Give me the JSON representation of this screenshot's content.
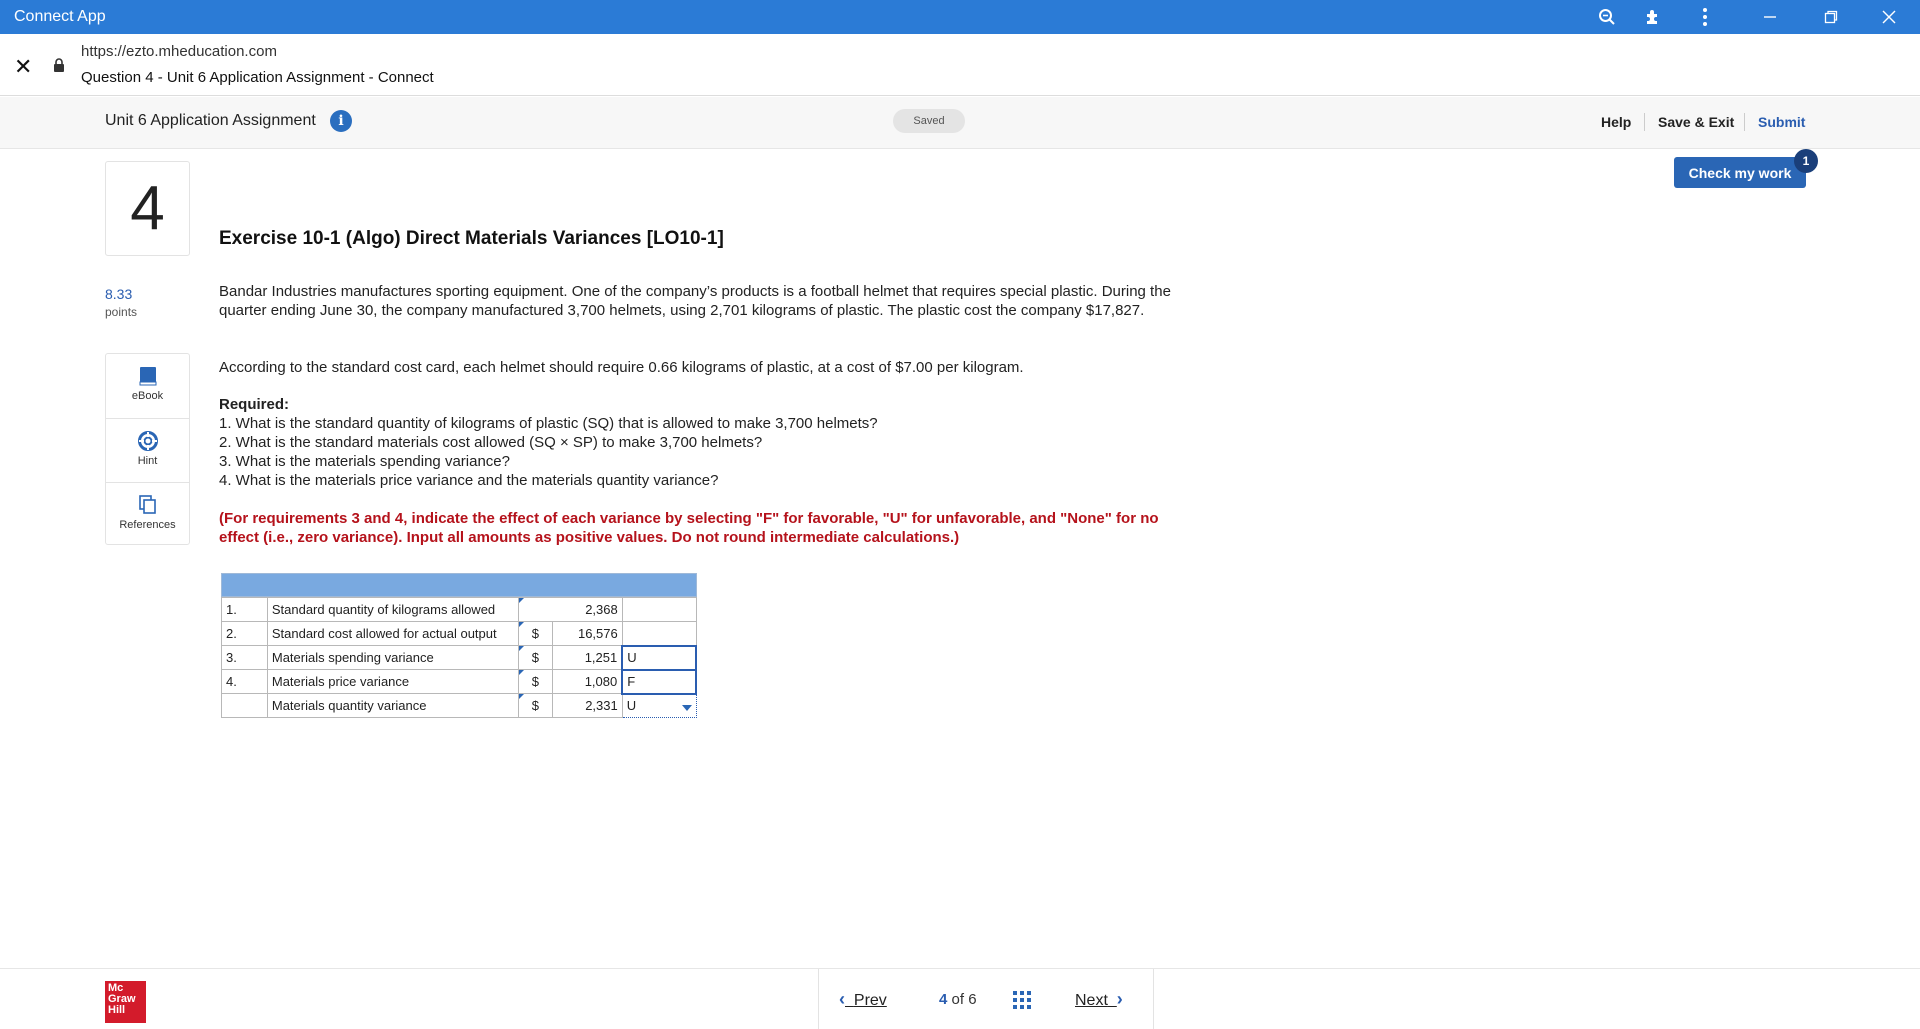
{
  "window": {
    "app_title": "Connect App"
  },
  "browser": {
    "url": "https://ezto.mheducation.com",
    "page_title": "Question 4 - Unit 6 Application Assignment - Connect"
  },
  "header": {
    "assignment_name": "Unit 6 Application Assignment",
    "info_glyph": "i",
    "saved_label": "Saved",
    "help_label": "Help",
    "save_exit_label": "Save & Exit",
    "submit_label": "Submit",
    "check_label": "Check my work",
    "check_badge": "1"
  },
  "question": {
    "number": "4",
    "points_value": "8.33",
    "points_label": "points",
    "title": "Exercise 10-1 (Algo) Direct Materials Variances [LO10-1]",
    "p1": "Bandar Industries manufactures sporting equipment. One of the company’s products is a football helmet that requires special plastic. During the quarter ending June 30, the company manufactured 3,700 helmets, using 2,701 kilograms of plastic. The plastic cost the company $17,827.",
    "p2": "According to the standard cost card, each helmet should require 0.66 kilograms of plastic, at a cost of $7.00 per kilogram.",
    "required_title": "Required:",
    "req1": "1. What is the standard quantity of kilograms of plastic (SQ) that is allowed to make 3,700 helmets?",
    "req2": "2. What is the standard materials cost allowed (SQ × SP) to make 3,700 helmets?",
    "req3": "3. What is the materials spending variance?",
    "req4": "4. What is the materials price variance and the materials quantity variance?",
    "instruction": "(For requirements 3 and 4, indicate the effect of each variance by selecting \"F\" for favorable, \"U\" for unfavorable, and \"None\" for no effect (i.e., zero variance). Input all amounts as positive values. Do not round intermediate calculations.)"
  },
  "tools": [
    {
      "label": "eBook",
      "icon": "book-icon"
    },
    {
      "label": "Hint",
      "icon": "lifebuoy-icon"
    },
    {
      "label": "References",
      "icon": "copy-icon"
    }
  ],
  "table": {
    "rows": [
      {
        "num": "1.",
        "desc": "Standard quantity of kilograms allowed",
        "cur": "",
        "value": "2,368",
        "effect": ""
      },
      {
        "num": "2.",
        "desc": "Standard cost allowed for actual output",
        "cur": "$",
        "value": "16,576",
        "effect": ""
      },
      {
        "num": "3.",
        "desc": "Materials spending variance",
        "cur": "$",
        "value": "1,251",
        "effect": "U"
      },
      {
        "num": "4.",
        "desc": "Materials price variance",
        "cur": "$",
        "value": "1,080",
        "effect": "F"
      },
      {
        "num": "",
        "desc": "Materials quantity variance",
        "cur": "$",
        "value": "2,331",
        "effect": "U"
      }
    ]
  },
  "footer": {
    "logo_line1": "Mc",
    "logo_line2": "Graw",
    "logo_line3": "Hill",
    "prev_label": "Prev",
    "next_label": "Next",
    "current_page": "4",
    "of_label": "of",
    "total_pages": "6"
  },
  "colors": {
    "titlebar": "#2b7bd6",
    "accent": "#2a5db0",
    "instruction_red": "#b5121b",
    "table_header": "#79a9e0"
  }
}
